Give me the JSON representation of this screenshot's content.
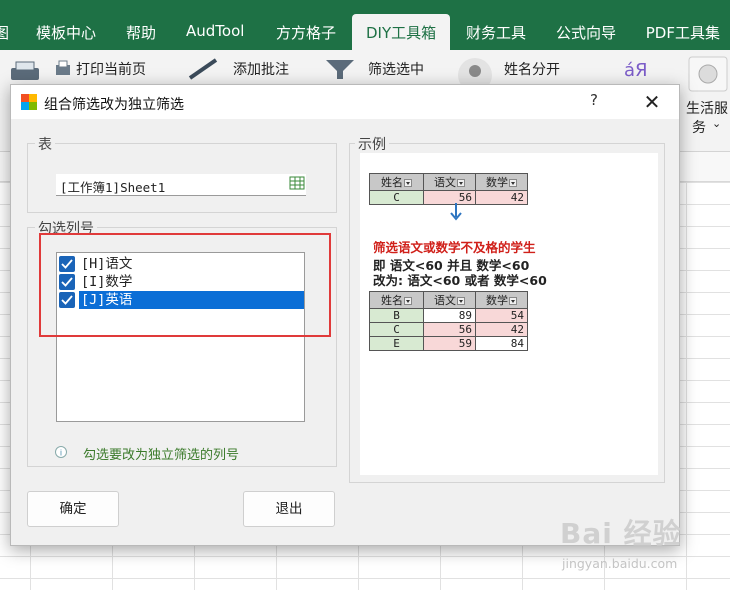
{
  "ribbon": {
    "tabs": [
      "图",
      "模板中心",
      "帮助",
      "AudTool",
      "方方格子",
      "DIY工具箱",
      "财务工具",
      "公式向导",
      "PDF工具集"
    ],
    "active_tab": "DIY工具箱",
    "buttons": {
      "print_current": "打印当前页",
      "add_comment": "添加批注",
      "filter_selected": "筛选选中",
      "split_name": "姓名分开",
      "life_service_1": "生活服",
      "life_service_2": "务",
      "lang_icon": "áЯ"
    }
  },
  "dialog": {
    "title": "组合筛选改为独立筛选",
    "help_label": "?",
    "close_label": "✕",
    "table_group": {
      "label": "表",
      "value": "[工作簿1]Sheet1"
    },
    "columns_group": {
      "label": "勾选列号",
      "items": [
        {
          "label": "[H]语文",
          "checked": true,
          "selected": false
        },
        {
          "label": "[I]数学",
          "checked": true,
          "selected": false
        },
        {
          "label": "[J]英语",
          "checked": true,
          "selected": true
        }
      ],
      "hint": "勾选要改为独立筛选的列号"
    },
    "example": {
      "label": "示例",
      "top_table": {
        "headers": [
          "姓名",
          "语文",
          "数学"
        ],
        "rows": [
          [
            "C",
            "56",
            "42"
          ]
        ]
      },
      "caption_red": "筛选语文或数学不及格的学生",
      "line_1": "即    语文<60 并且 数学<60",
      "line_2": "改为: 语文<60 或者 数学<60",
      "bottom_table": {
        "headers": [
          "姓名",
          "语文",
          "数学"
        ],
        "rows": [
          [
            "B",
            "89",
            "54"
          ],
          [
            "C",
            "56",
            "42"
          ],
          [
            "E",
            "59",
            "84"
          ]
        ]
      }
    },
    "ok_label": "确定",
    "exit_label": "退出"
  },
  "colors": {
    "excel_green": "#1e7145",
    "highlight_box": "#e03a3a",
    "selection_blue": "#0b6ed6"
  },
  "watermark": {
    "logo": "Bai 经验",
    "url": "jingyan.baidu.com"
  }
}
